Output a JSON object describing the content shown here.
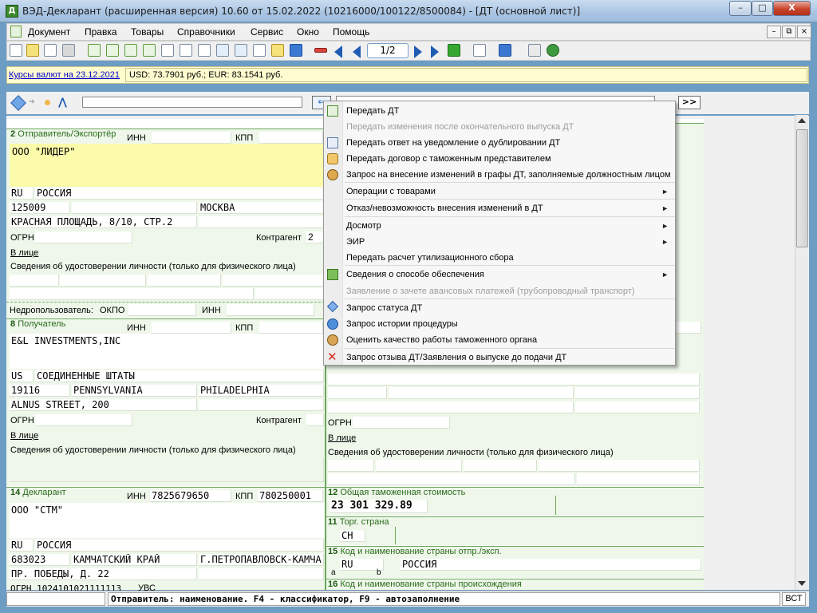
{
  "window": {
    "title": "ВЭД-Декларант (расширенная версия) 10.60 от 15.02.2022  (10216000/100122/8500084) - [ДТ (основной лист)]",
    "minimize_label": "–",
    "maximize_label": "□",
    "close_label": "X"
  },
  "menubar": {
    "items": [
      "Документ",
      "Правка",
      "Товары",
      "Справочники",
      "Сервис",
      "Окно",
      "Помощь"
    ],
    "mdi": [
      "–",
      "⧉",
      "×"
    ]
  },
  "toolbar": {
    "page_counter": "1/2"
  },
  "currency": {
    "link": "Курсы валют на 23.12.2021",
    "values": "USD: 73.7901 руб.; EUR: 83.1541 руб."
  },
  "formbar": {
    "back_label": "⇐",
    "forward_label": ">>"
  },
  "sections": {
    "sender": {
      "num": "2",
      "title": "Отправитель/Экспортёр",
      "inn_label": "ИНН",
      "kpp_label": "КПП",
      "name": "ООО \"ЛИДЕР\"",
      "country_code": "RU",
      "country_name": "РОССИЯ",
      "postal": "125009",
      "city": "МОСКВА",
      "street": "КРАСНАЯ ПЛОЩАДЬ, 8/10, СТР.2",
      "ogrn_label": "ОГРН",
      "counterparty_label": "Контрагент",
      "counterparty_value": "2",
      "person_label": "В лице",
      "id_label": "Сведения об удостоверении личности (только для физического лица)",
      "subsoil_label": "Недропользователь:",
      "okpo_label": "ОКПО",
      "inn2_label": "ИНН"
    },
    "receiver": {
      "num": "8",
      "title": "Получатель",
      "inn_label": "ИНН",
      "kpp_label": "КПП",
      "name": "E&L INVESTMENTS,INC",
      "country_code": "US",
      "country_name": "СОЕДИНЕННЫЕ ШТАТЫ",
      "postal": "19116",
      "region": "PENNSYLVANIA",
      "city": "PHILADELPHIA",
      "street": "ALNUS STREET, 200",
      "ogrn_label": "ОГРН",
      "counterparty_label": "Контрагент",
      "person_label": "В лице",
      "id_label": "Сведения об удостоверении личности (только для физического лица)"
    },
    "right_panel": {
      "ogrn_label": "ОГРН",
      "person_label": "В лице",
      "id_label": "Сведения об удостоверении личности (только для физического лица)"
    },
    "declarant": {
      "num": "14",
      "title": "Декларант",
      "inn_label": "ИНН",
      "inn_value": "7825679650",
      "kpp_label": "КПП",
      "kpp_value": "780250001",
      "name": "ООО \"СТМ\"",
      "country_code": "RU",
      "country_name": "РОССИЯ",
      "postal": "683023",
      "region": "КАМЧАТСКИЙ КРАЙ",
      "city": "Г.ПЕТРОПАВЛОВСК-КАМЧА",
      "street": "ПР. ПОБЕДЫ, Д. 22",
      "ogrn_partial": "ОГРН 1024101021111113",
      "extra_label": "УВС"
    },
    "customs_value": {
      "num": "12",
      "title": "Общая таможенная стоимость",
      "value": "23 301 329.89"
    },
    "trade_country": {
      "num": "11",
      "title": "Торг. страна",
      "value": "CH"
    },
    "dispatch_country": {
      "num": "15",
      "title": "Код и наименование страны отпр./эксп.",
      "code": "RU",
      "name": "РОССИЯ",
      "a_label": "a",
      "b_label": "b"
    },
    "origin_country": {
      "num": "16",
      "title": "Код и наименование страны происхождения"
    }
  },
  "context_menu": {
    "items": [
      {
        "label": "Передать ДТ",
        "disabled": false,
        "submenu": false,
        "icon": "send-doc-icon"
      },
      {
        "label": "Передать изменения после окончательного выпуска ДТ",
        "disabled": true,
        "submenu": false,
        "icon": ""
      },
      {
        "label": "Передать ответ на уведомление о дублировании ДТ",
        "disabled": false,
        "submenu": false,
        "icon": "reply-doc-icon"
      },
      {
        "label": "Передать договор с таможенным представителем",
        "disabled": false,
        "submenu": false,
        "icon": "handshake-icon"
      },
      {
        "label": "Запрос на внесение изменений в графы ДТ, заполняемые должностным лицом",
        "disabled": false,
        "submenu": false,
        "icon": "officer-icon"
      },
      {
        "label": "Операции с товарами",
        "disabled": false,
        "submenu": true,
        "icon": ""
      },
      {
        "label": "Отказ/невозможность внесения изменений в ДТ",
        "disabled": false,
        "submenu": true,
        "icon": ""
      },
      {
        "label": "Досмотр",
        "disabled": false,
        "submenu": true,
        "icon": ""
      },
      {
        "label": "ЭИР",
        "disabled": false,
        "submenu": true,
        "icon": ""
      },
      {
        "label": "Передать расчет утилизационного сбора",
        "disabled": false,
        "submenu": false,
        "icon": ""
      },
      {
        "label": "Сведения о способе обеспечения",
        "disabled": false,
        "submenu": true,
        "icon": "money-icon"
      },
      {
        "label": "Заявление о зачете авансовых платежей (трубопроводный транспорт)",
        "disabled": true,
        "submenu": false,
        "icon": ""
      },
      {
        "label": "Запрос статуса ДТ",
        "disabled": false,
        "submenu": false,
        "icon": "status-diamond-icon"
      },
      {
        "label": "Запрос истории процедуры",
        "disabled": false,
        "submenu": false,
        "icon": "history-globe-icon"
      },
      {
        "label": "Оценить качество работы таможенного органа",
        "disabled": false,
        "submenu": false,
        "icon": "rate-officer-icon"
      },
      {
        "label": "Запрос отзыва ДТ/Заявления о выпуске до подачи ДТ",
        "disabled": false,
        "submenu": false,
        "icon": "red-cross-icon"
      }
    ],
    "submenu_arrow": "►"
  },
  "statusbar": {
    "text": "Отправитель: наименование. F4 - классификатор, F9 - автозаполнение",
    "mode": "ВСТ"
  },
  "colors": {
    "section_bg": "#eef7ea",
    "section_title": "#2a6a1c",
    "yellow_field": "#fbfbaa",
    "currency_bar": "#fffccf"
  }
}
